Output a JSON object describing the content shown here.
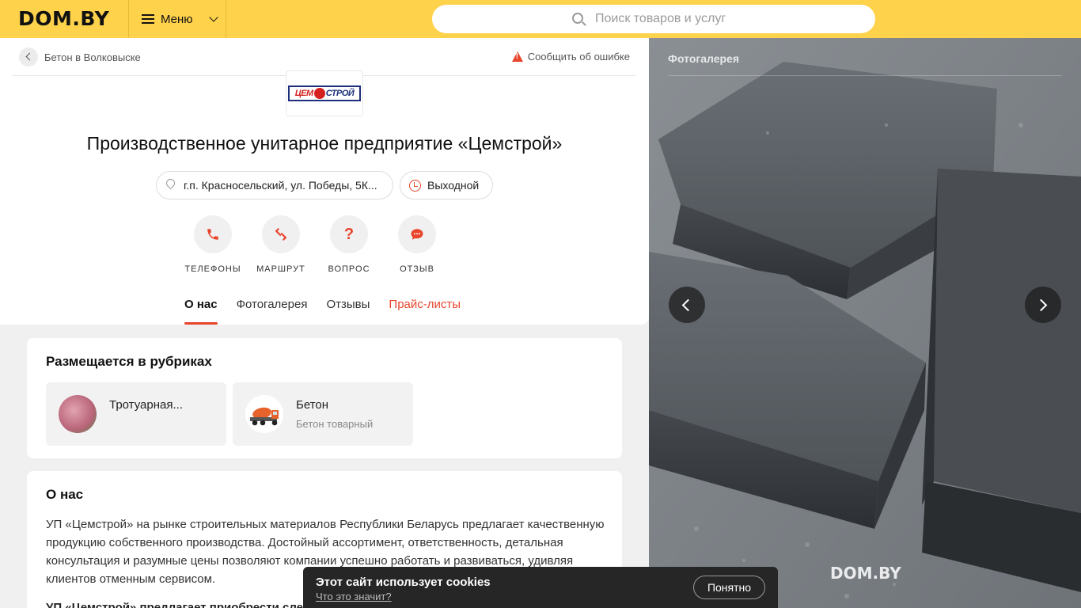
{
  "header": {
    "logo": "DOM.BY",
    "menu_label": "Меню",
    "search_placeholder": "Поиск товаров и услуг"
  },
  "breadcrumb": {
    "label": "Бетон в Волковыске"
  },
  "report_label": "Сообщить об ошибке",
  "company": {
    "logo_left": "ЦЕМ",
    "logo_right": "СТРОЙ",
    "title": "Производственное унитарное предприятие «Цемстрой»",
    "address": "г.п. Красносельский, ул. Победы, 5К...",
    "hours": "Выходной"
  },
  "actions": [
    {
      "label": "ТЕЛЕФОНЫ",
      "icon": "phone-icon"
    },
    {
      "label": "МАРШРУТ",
      "icon": "route-icon"
    },
    {
      "label": "ВОПРОС",
      "icon": "question-icon"
    },
    {
      "label": "ОТЗЫВ",
      "icon": "review-icon"
    }
  ],
  "tabs": [
    {
      "label": "О нас",
      "active": true
    },
    {
      "label": "Фотогалерея",
      "active": false
    },
    {
      "label": "Отзывы",
      "active": false
    },
    {
      "label": "Прайс-листы",
      "active": false
    }
  ],
  "rubrics": {
    "heading": "Размещается в рубриках",
    "items": [
      {
        "title": "Тротуарная...",
        "subtitle": ""
      },
      {
        "title": "Бетон",
        "subtitle": "Бетон товарный"
      }
    ]
  },
  "about": {
    "heading": "О нас",
    "text": "УП «Цемстрой» на рынке строительных материалов Республики Беларусь предлагает качественную продукцию собственного производства. Достойный ассортимент, ответственность, детальная консультация и разумные цены позволяют компании успешно работать и развиваться, удивляя клиентов отменным сервисом.",
    "text2": "УП «Цемстрой» предлагает приобрести следу"
  },
  "gallery": {
    "title": "Фотогалерея",
    "watermark": "DOM.BY"
  },
  "cookie": {
    "title": "Этот сайт использует cookies",
    "link": "Что это значит?",
    "button": "Понятно"
  },
  "colors": {
    "brand_yellow": "#ffd24c",
    "accent_red": "#e8452c"
  }
}
